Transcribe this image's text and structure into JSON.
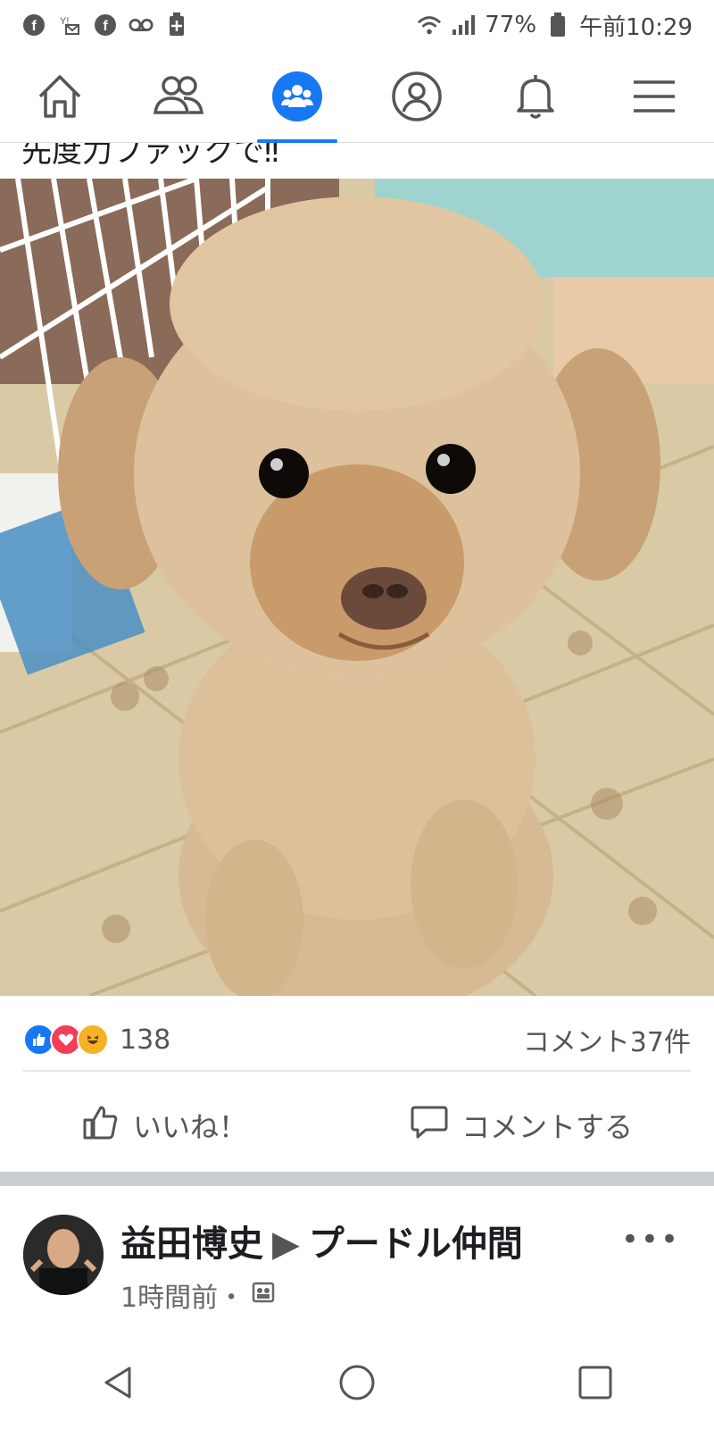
{
  "status_bar": {
    "battery": "77%",
    "time": "午前10:29",
    "left_icons": [
      "facebook-icon",
      "yahoo-mail-icon",
      "facebook-icon",
      "voicemail-icon",
      "battery-plus-icon"
    ]
  },
  "top_nav": {
    "items": [
      "home",
      "friends",
      "groups",
      "profile",
      "notifications",
      "menu"
    ],
    "active": "groups",
    "accent": "#1877f2"
  },
  "post": {
    "cut_text": "先度力ファックで‼",
    "reaction_count": "138",
    "comment_count": "コメント37件",
    "like_label": "いいね！",
    "comment_label": "コメントする"
  },
  "next_post": {
    "author": "益田博史",
    "group": "プードル仲間",
    "time": "1時間前・",
    "more": "•••"
  }
}
